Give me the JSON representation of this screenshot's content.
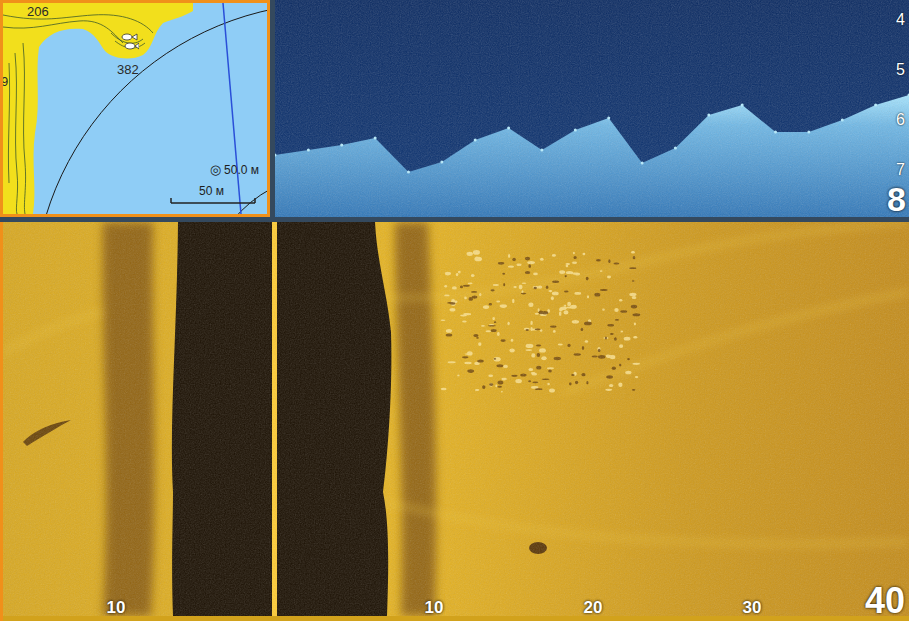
{
  "map": {
    "depth_labels": [
      "206",
      "382",
      "9"
    ],
    "range_icon": "◎",
    "range": "50.0 м",
    "scale": "50 м"
  },
  "downscan": {
    "depth_ticks": [
      "4",
      "5",
      "6",
      "7"
    ],
    "range": "8",
    "bottom_profile": [
      6.7,
      6.6,
      6.5,
      6.36,
      7.04,
      6.84,
      6.4,
      6.16,
      6.6,
      6.2,
      5.96,
      6.86,
      6.56,
      5.9,
      5.7,
      6.24,
      6.24,
      6.0,
      5.7,
      5.5
    ]
  },
  "sidescan": {
    "ticks": [
      {
        "label": "10",
        "side": "port"
      },
      {
        "label": "10",
        "side": "starboard"
      },
      {
        "label": "20",
        "side": "starboard"
      },
      {
        "label": "30",
        "side": "starboard"
      }
    ],
    "range": "40"
  }
}
